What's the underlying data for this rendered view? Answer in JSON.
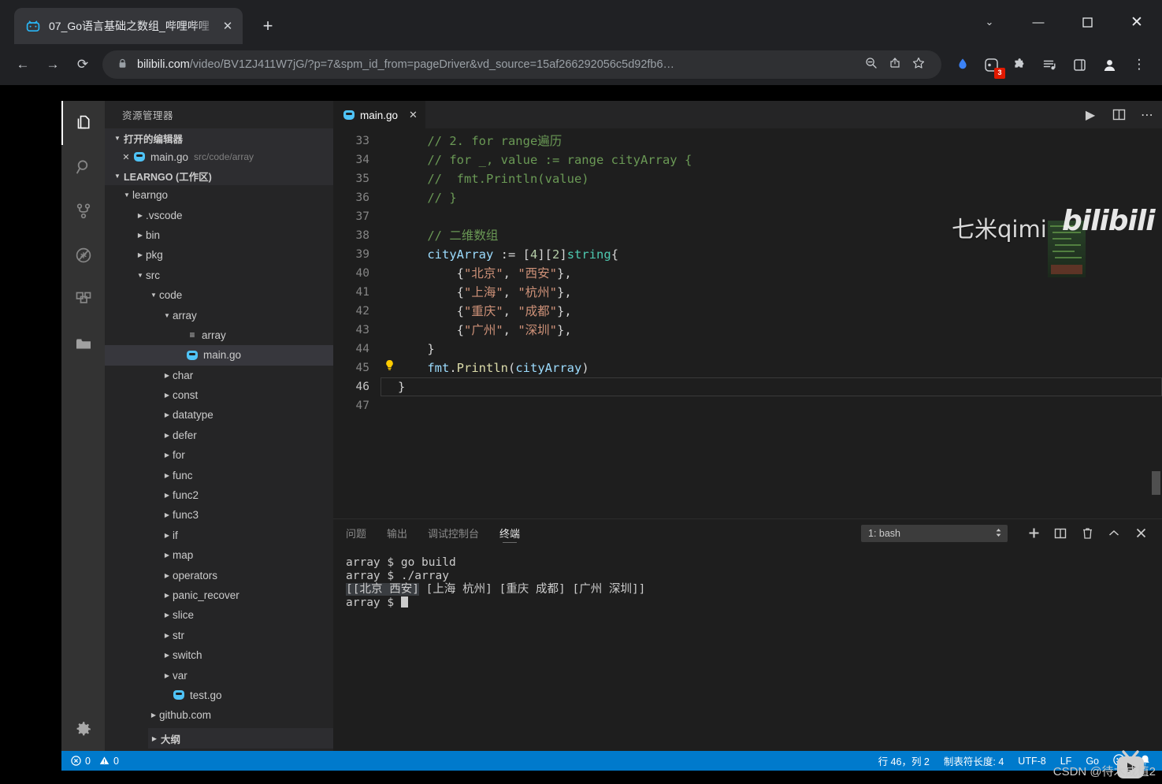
{
  "browser": {
    "tab": {
      "title": "07_Go语言基础之数组_哔哩哔哩",
      "favicon": "bilibili-tv-icon",
      "close": "✕"
    },
    "newtab_label": "+",
    "window": {
      "minimize": "—",
      "maximize": "▢",
      "close": "✕",
      "chevron": "⌄"
    },
    "nav": {
      "back": "←",
      "forward": "→",
      "reload": "⟳"
    },
    "omnibox": {
      "lock": "🔒",
      "url_host": "bilibili.com",
      "url_rest": "/video/BV1ZJ411W7jG/?p=7&spm_id_from=pageDriver&vd_source=15af266292056c5d92fb6…",
      "zoom_icon": "search-minus-icon",
      "share_icon": "share-icon",
      "bookmark_icon": "star-icon"
    },
    "actions": {
      "translate": "translate-icon",
      "extension_badge_count": "3",
      "puzzle": "extensions-icon",
      "reading_list": "reading-list-icon",
      "sidepanel": "side-panel-icon",
      "profile": "profile-icon",
      "menu": "⋮"
    }
  },
  "vscode": {
    "activitybar": [
      {
        "name": "explorer-icon",
        "label": "资源管理器",
        "active": true
      },
      {
        "name": "search-icon",
        "label": "搜索",
        "active": false
      },
      {
        "name": "source-control-icon",
        "label": "源代码管理",
        "active": false
      },
      {
        "name": "run-debug-icon",
        "label": "运行和调试",
        "active": false
      },
      {
        "name": "extensions-icon",
        "label": "扩展",
        "active": false
      },
      {
        "name": "remote-explorer-icon",
        "label": "远程资源管理器",
        "active": false
      }
    ],
    "activitybar_bottom": [
      {
        "name": "settings-gear-icon",
        "label": "管理"
      }
    ],
    "explorer": {
      "title": "资源管理器",
      "open_editors": {
        "label": "打开的编辑器",
        "items": [
          {
            "close": "✕",
            "name": "main.go",
            "path": "src/code/array"
          }
        ]
      },
      "workspace_label": "LEARNGO (工作区)",
      "tree": [
        {
          "label": "learngo",
          "depth": 1,
          "arrow": "open",
          "type": "folder"
        },
        {
          "label": ".vscode",
          "depth": 2,
          "arrow": "closed",
          "type": "folder"
        },
        {
          "label": "bin",
          "depth": 2,
          "arrow": "closed",
          "type": "folder"
        },
        {
          "label": "pkg",
          "depth": 2,
          "arrow": "closed",
          "type": "folder"
        },
        {
          "label": "src",
          "depth": 2,
          "arrow": "open",
          "type": "folder"
        },
        {
          "label": "code",
          "depth": 3,
          "arrow": "open",
          "type": "folder"
        },
        {
          "label": "array",
          "depth": 4,
          "arrow": "open",
          "type": "folder"
        },
        {
          "label": "array",
          "depth": 5,
          "arrow": "none",
          "type": "binary"
        },
        {
          "label": "main.go",
          "depth": 5,
          "arrow": "none",
          "type": "go",
          "selected": true
        },
        {
          "label": "char",
          "depth": 4,
          "arrow": "closed",
          "type": "folder"
        },
        {
          "label": "const",
          "depth": 4,
          "arrow": "closed",
          "type": "folder"
        },
        {
          "label": "datatype",
          "depth": 4,
          "arrow": "closed",
          "type": "folder"
        },
        {
          "label": "defer",
          "depth": 4,
          "arrow": "closed",
          "type": "folder"
        },
        {
          "label": "for",
          "depth": 4,
          "arrow": "closed",
          "type": "folder"
        },
        {
          "label": "func",
          "depth": 4,
          "arrow": "closed",
          "type": "folder"
        },
        {
          "label": "func2",
          "depth": 4,
          "arrow": "closed",
          "type": "folder"
        },
        {
          "label": "func3",
          "depth": 4,
          "arrow": "closed",
          "type": "folder"
        },
        {
          "label": "if",
          "depth": 4,
          "arrow": "closed",
          "type": "folder"
        },
        {
          "label": "map",
          "depth": 4,
          "arrow": "closed",
          "type": "folder"
        },
        {
          "label": "operators",
          "depth": 4,
          "arrow": "closed",
          "type": "folder"
        },
        {
          "label": "panic_recover",
          "depth": 4,
          "arrow": "closed",
          "type": "folder"
        },
        {
          "label": "slice",
          "depth": 4,
          "arrow": "closed",
          "type": "folder"
        },
        {
          "label": "str",
          "depth": 4,
          "arrow": "closed",
          "type": "folder"
        },
        {
          "label": "switch",
          "depth": 4,
          "arrow": "closed",
          "type": "folder"
        },
        {
          "label": "var",
          "depth": 4,
          "arrow": "closed",
          "type": "folder"
        },
        {
          "label": "test.go",
          "depth": 4,
          "arrow": "none",
          "type": "go"
        },
        {
          "label": "github.com",
          "depth": 3,
          "arrow": "closed",
          "type": "folder"
        }
      ],
      "outline_label": "大纲"
    },
    "editor": {
      "tab": {
        "label": "main.go",
        "close": "✕",
        "icon": "go-gopher-icon"
      },
      "actions": [
        {
          "name": "run-code-icon",
          "glyph": "▶"
        },
        {
          "name": "split-editor-icon",
          "glyph": "▥"
        },
        {
          "name": "more-actions-icon",
          "glyph": "⋯"
        }
      ],
      "first_line_number": 33,
      "lines": [
        {
          "n": 33,
          "segments": [
            {
              "t": "    // 2. for range遍历",
              "c": "cm"
            }
          ]
        },
        {
          "n": 34,
          "segments": [
            {
              "t": "    // for _, value := range cityArray {",
              "c": "cm"
            }
          ]
        },
        {
          "n": 35,
          "segments": [
            {
              "t": "    //  fmt.Println(value)",
              "c": "cm"
            }
          ]
        },
        {
          "n": 36,
          "segments": [
            {
              "t": "    // }",
              "c": "cm"
            }
          ]
        },
        {
          "n": 37,
          "segments": [
            {
              "t": "",
              "c": "pl"
            }
          ]
        },
        {
          "n": 38,
          "segments": [
            {
              "t": "    // 二维数组",
              "c": "cm"
            }
          ]
        },
        {
          "n": 39,
          "segments": [
            {
              "t": "    ",
              "c": "pl"
            },
            {
              "t": "cityArray",
              "c": "var"
            },
            {
              "t": " := [",
              "c": "pl"
            },
            {
              "t": "4",
              "c": "num"
            },
            {
              "t": "][",
              "c": "pl"
            },
            {
              "t": "2",
              "c": "num"
            },
            {
              "t": "]",
              "c": "pl"
            },
            {
              "t": "string",
              "c": "typ"
            },
            {
              "t": "{",
              "c": "pl"
            }
          ]
        },
        {
          "n": 40,
          "segments": [
            {
              "t": "        {",
              "c": "pl"
            },
            {
              "t": "\"北京\"",
              "c": "str"
            },
            {
              "t": ", ",
              "c": "pl"
            },
            {
              "t": "\"西安\"",
              "c": "str"
            },
            {
              "t": "},",
              "c": "pl"
            }
          ]
        },
        {
          "n": 41,
          "segments": [
            {
              "t": "        {",
              "c": "pl"
            },
            {
              "t": "\"上海\"",
              "c": "str"
            },
            {
              "t": ", ",
              "c": "pl"
            },
            {
              "t": "\"杭州\"",
              "c": "str"
            },
            {
              "t": "},",
              "c": "pl"
            }
          ]
        },
        {
          "n": 42,
          "segments": [
            {
              "t": "        {",
              "c": "pl"
            },
            {
              "t": "\"重庆\"",
              "c": "str"
            },
            {
              "t": ", ",
              "c": "pl"
            },
            {
              "t": "\"成都\"",
              "c": "str"
            },
            {
              "t": "},",
              "c": "pl"
            }
          ]
        },
        {
          "n": 43,
          "segments": [
            {
              "t": "        {",
              "c": "pl"
            },
            {
              "t": "\"广州\"",
              "c": "str"
            },
            {
              "t": ", ",
              "c": "pl"
            },
            {
              "t": "\"深圳\"",
              "c": "str"
            },
            {
              "t": "},",
              "c": "pl"
            }
          ]
        },
        {
          "n": 44,
          "segments": [
            {
              "t": "    }",
              "c": "pl"
            }
          ]
        },
        {
          "n": 45,
          "bulb": "💡",
          "segments": [
            {
              "t": "    ",
              "c": "pl"
            },
            {
              "t": "fmt",
              "c": "var"
            },
            {
              "t": ".",
              "c": "pl"
            },
            {
              "t": "Println",
              "c": "fn"
            },
            {
              "t": "(",
              "c": "pl"
            },
            {
              "t": "cityArray",
              "c": "var"
            },
            {
              "t": ")",
              "c": "pl"
            }
          ]
        },
        {
          "n": 46,
          "current": true,
          "segments": [
            {
              "t": "}",
              "c": "pl"
            }
          ]
        },
        {
          "n": 47,
          "segments": [
            {
              "t": "",
              "c": "pl"
            }
          ]
        }
      ]
    },
    "panel": {
      "tabs": [
        {
          "label": "问题",
          "active": false
        },
        {
          "label": "输出",
          "active": false
        },
        {
          "label": "调试控制台",
          "active": false
        },
        {
          "label": "终端",
          "active": true
        }
      ],
      "terminal_select": {
        "value": "1: bash",
        "caret": "⇅"
      },
      "actions": [
        {
          "name": "new-terminal-icon",
          "glyph": "＋"
        },
        {
          "name": "split-terminal-icon",
          "glyph": "▥"
        },
        {
          "name": "kill-terminal-icon",
          "glyph": "🗑"
        },
        {
          "name": "maximize-panel-icon",
          "glyph": "⌃"
        },
        {
          "name": "close-panel-icon",
          "glyph": "✕"
        }
      ],
      "terminal_lines": [
        {
          "text": "array $ go build"
        },
        {
          "text": "array $ ./array"
        },
        {
          "text": "[[北京 西安] [上海 杭州] [重庆 成都] [广州 深圳]]",
          "selection": "[[北京 西安]"
        },
        {
          "text": "array $ ",
          "cursor": true
        }
      ]
    },
    "statusbar": {
      "errors_icon": "error-circle-icon",
      "errors": "0",
      "warnings_icon": "warning-triangle-icon",
      "warnings": "0",
      "cursor_position": "行 46，列 2",
      "indentation": "制表符长度: 4",
      "encoding": "UTF-8",
      "eol": "LF",
      "language": "Go",
      "feedback_icon": "smiley-icon",
      "notifications_icon": "bell-icon",
      "accent": "#007acc"
    }
  },
  "watermarks": {
    "uploader": "七米qimi",
    "site": "bilibili",
    "csdn": "CSDN @待木成植2",
    "player_badge": "bilibili-tv-play-icon"
  }
}
